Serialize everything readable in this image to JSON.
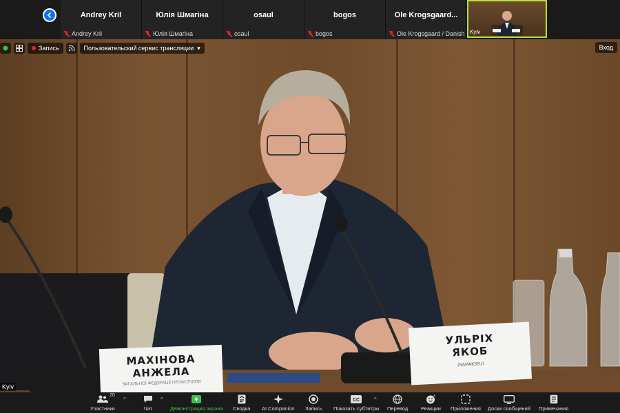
{
  "top_strip": {
    "participants": [
      {
        "tile_name": "Andrey Kril",
        "footer_name": "Andrey Kril"
      },
      {
        "tile_name": "Юлія Шмагіна",
        "footer_name": "Юлія Шмагіна"
      },
      {
        "tile_name": "osaul",
        "footer_name": "osaul"
      },
      {
        "tile_name": "bogos",
        "footer_name": "bogos"
      },
      {
        "tile_name": "Ole  Krogsgaard...",
        "footer_name": "Ole Krogsgaard / Danish l..."
      }
    ],
    "active_speaker_label": "Kyiv"
  },
  "video": {
    "record_label": "Запись",
    "stream_label": "Пользовательский сервис трансляции",
    "login_label": "Вход",
    "location_label": "Kyiv",
    "nameplate_main": {
      "line1": "УЛЬРІХ",
      "line2": "ЯКОБ",
      "line3": "(NAMAKSEU)"
    },
    "nameplate_side": {
      "line1": "МАХІНОВА",
      "line2": "АНЖЕЛА",
      "line3": "ЗАГАЛЬНОЇ ФЕДЕРАЦІЇ ПРОФСПІЛОК"
    }
  },
  "toolbar": {
    "participants_count": "20",
    "items": {
      "participants": "Участники",
      "chat": "Чат",
      "share": "Демонстрация экрана",
      "summary": "Сводка",
      "companion": "AI Companion",
      "record": "Запись",
      "captions": "Показать субтитры",
      "translate": "Перевод",
      "reactions": "Реакции",
      "apps": "Приложения",
      "whiteboards": "Доски сообщений",
      "notes": "Примечания"
    }
  },
  "colors": {
    "accent_blue": "#0e72ed",
    "active_speaker_border": "#b7e33a",
    "share_green": "#37c14a",
    "mute_red": "#e02828"
  }
}
